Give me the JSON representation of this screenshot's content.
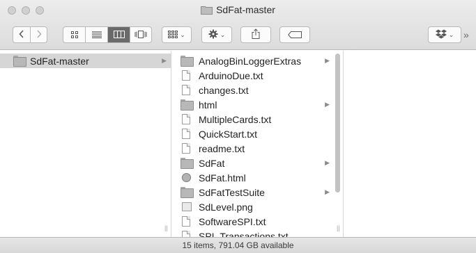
{
  "window": {
    "title": "SdFat-master"
  },
  "toolbar": {
    "back_icon": "chevron-left-icon",
    "forward_icon": "chevron-right-icon",
    "view_icons": [
      "icon-view-icon",
      "list-view-icon",
      "column-view-icon",
      "coverflow-view-icon"
    ],
    "arrange_icon": "arrange-grid-icon",
    "action_icon": "gear-icon",
    "share_icon": "share-icon",
    "tag_icon": "tag-icon",
    "dropbox_icon": "dropbox-icon",
    "overflow": "»"
  },
  "column1": {
    "items": [
      {
        "label": "SdFat-master",
        "type": "folder",
        "selected": true
      }
    ]
  },
  "column2": {
    "items": [
      {
        "label": "AnalogBinLoggerExtras",
        "type": "folder"
      },
      {
        "label": "ArduinoDue.txt",
        "type": "doc"
      },
      {
        "label": "changes.txt",
        "type": "doc"
      },
      {
        "label": "html",
        "type": "folder"
      },
      {
        "label": "MultipleCards.txt",
        "type": "doc"
      },
      {
        "label": "QuickStart.txt",
        "type": "doc"
      },
      {
        "label": "readme.txt",
        "type": "doc"
      },
      {
        "label": "SdFat",
        "type": "folder"
      },
      {
        "label": "SdFat.html",
        "type": "html"
      },
      {
        "label": "SdFatTestSuite",
        "type": "folder"
      },
      {
        "label": "SdLevel.png",
        "type": "image"
      },
      {
        "label": "SoftwareSPI.txt",
        "type": "doc"
      },
      {
        "label": "SPI_Transactions.txt",
        "type": "doc"
      }
    ]
  },
  "status": {
    "text": "15 items, 791.04 GB available"
  }
}
